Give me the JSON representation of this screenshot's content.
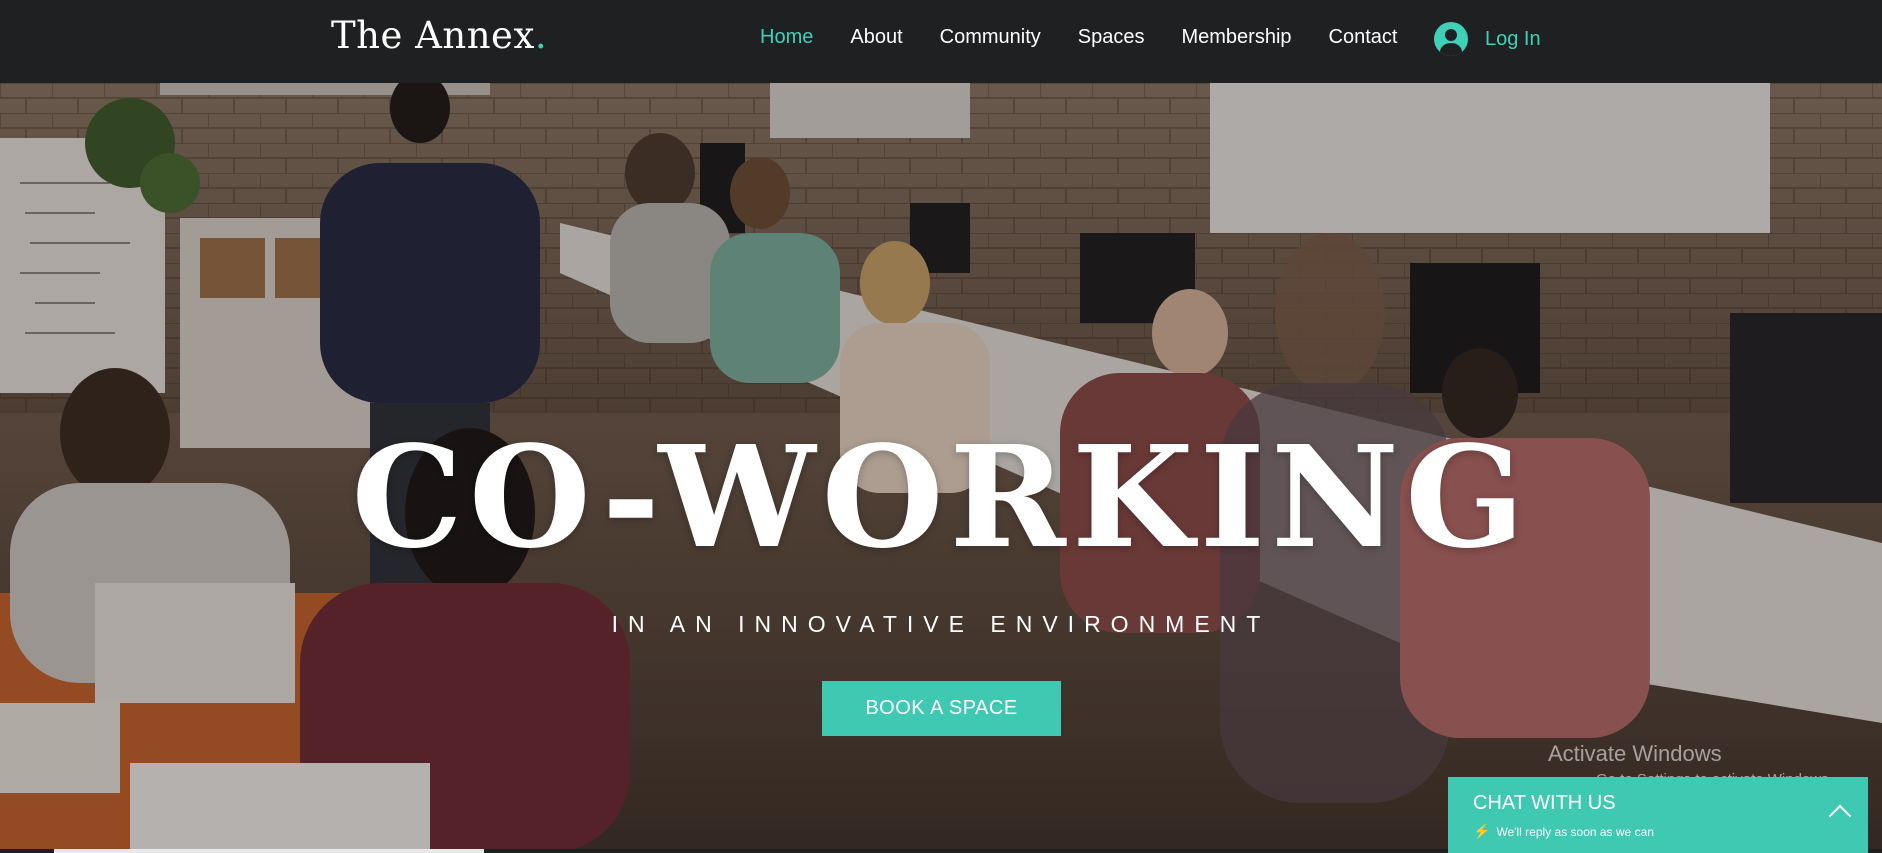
{
  "header": {
    "logo_text": "The Annex",
    "logo_dot": ".",
    "nav": [
      "Home",
      "About",
      "Community",
      "Spaces",
      "Membership",
      "Contact"
    ],
    "active": "Home",
    "login_label": "Log In"
  },
  "hero": {
    "headline": "CO-WORKING",
    "tagline": "IN AN INNOVATIVE ENVIRONMENT",
    "cta_label": "BOOK A SPACE",
    "background": "office-photo"
  },
  "watermark": {
    "line1": "Activate Windows",
    "line2": "Go to Settings to activate Windows."
  },
  "chat": {
    "title": "CHAT WITH US",
    "subtitle": "We'll reply as soon as we can",
    "icon": "bolt-icon"
  },
  "colors": {
    "accent": "#3fd1b8",
    "header_bg": "#1f2021",
    "button_bg": "#3fc8b2"
  }
}
